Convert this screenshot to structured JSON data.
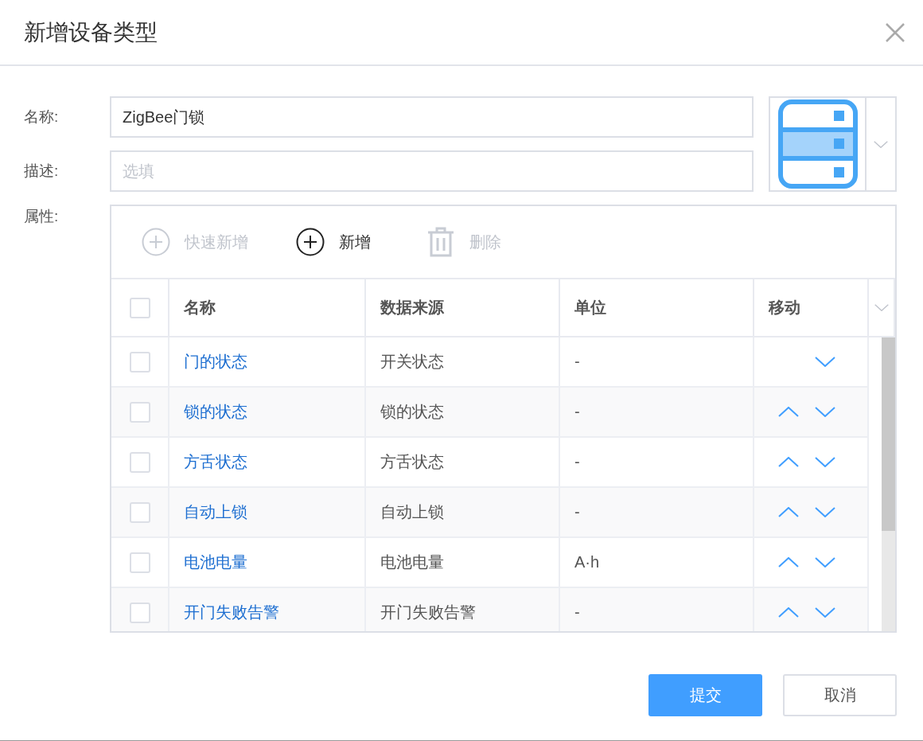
{
  "dialog": {
    "title": "新增设备类型"
  },
  "form": {
    "name_label": "名称:",
    "name_value": "ZigBee门锁",
    "description_label": "描述:",
    "description_placeholder": "选填",
    "attributes_label": "属性:"
  },
  "toolbar": [
    {
      "kind": "add",
      "label": "快速新增",
      "disabled": true
    },
    {
      "kind": "add",
      "label": "新增",
      "disabled": false
    },
    {
      "kind": "delete",
      "label": "删除",
      "disabled": true
    }
  ],
  "table": {
    "select_all_checked": false,
    "columns": [
      "名称",
      "数据来源",
      "单位",
      "移动"
    ],
    "rows": [
      {
        "name": "门的状态",
        "source": "开关状态",
        "unit": "-",
        "checked": false,
        "can_move_up": false,
        "can_move_down": true
      },
      {
        "name": "锁的状态",
        "source": "锁的状态",
        "unit": "-",
        "checked": false,
        "can_move_up": true,
        "can_move_down": true
      },
      {
        "name": "方舌状态",
        "source": "方舌状态",
        "unit": "-",
        "checked": false,
        "can_move_up": true,
        "can_move_down": true
      },
      {
        "name": "自动上锁",
        "source": "自动上锁",
        "unit": "-",
        "checked": false,
        "can_move_up": true,
        "can_move_down": true
      },
      {
        "name": "电池电量",
        "source": "电池电量",
        "unit": "A·h",
        "checked": false,
        "can_move_up": true,
        "can_move_down": true
      },
      {
        "name": "开门失败告警",
        "source": "开门失败告警",
        "unit": "-",
        "checked": false,
        "can_move_up": true,
        "can_move_down": true
      }
    ]
  },
  "buttons": [
    {
      "kind": "primary",
      "label": "提交"
    },
    {
      "kind": "default",
      "label": "取消"
    }
  ]
}
